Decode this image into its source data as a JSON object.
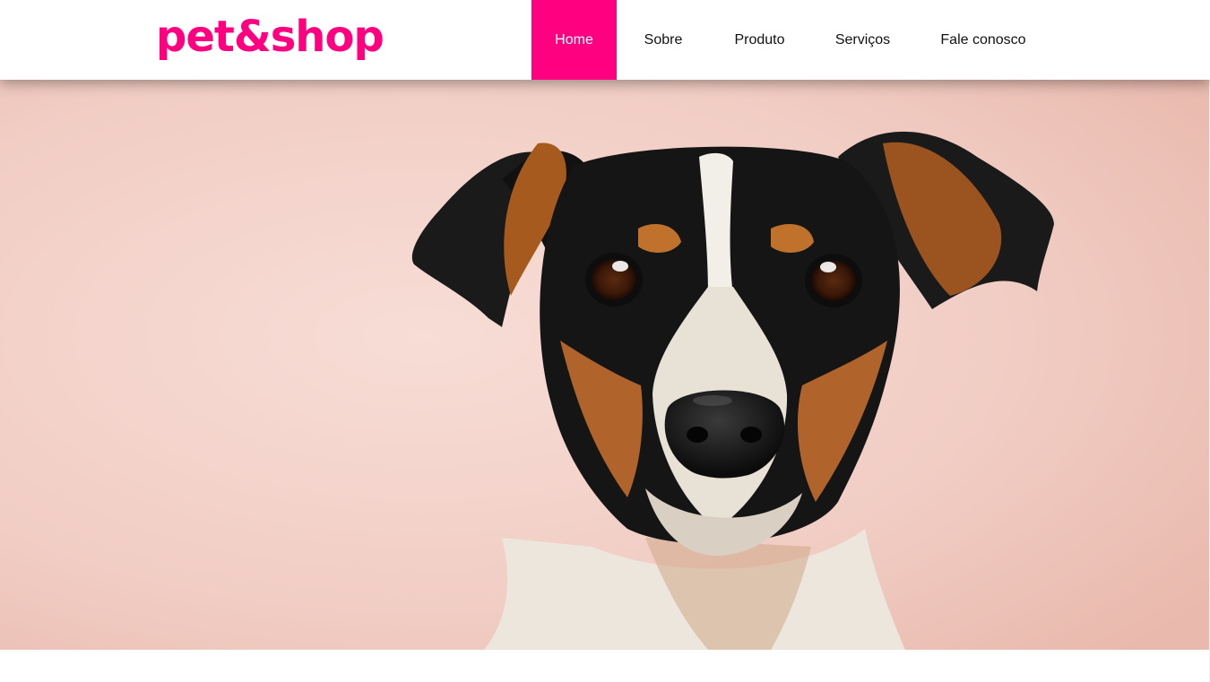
{
  "brand": {
    "logo_text": "pet&shop",
    "accent_color": "#ff0080"
  },
  "nav": {
    "items": [
      {
        "label": "Home",
        "active": true
      },
      {
        "label": "Sobre",
        "active": false
      },
      {
        "label": "Produto",
        "active": false
      },
      {
        "label": "Serviços",
        "active": false
      },
      {
        "label": "Fale conosco",
        "active": false
      }
    ]
  },
  "hero": {
    "image_subject": "dog-portrait",
    "background_color": "#f2cfc6"
  }
}
